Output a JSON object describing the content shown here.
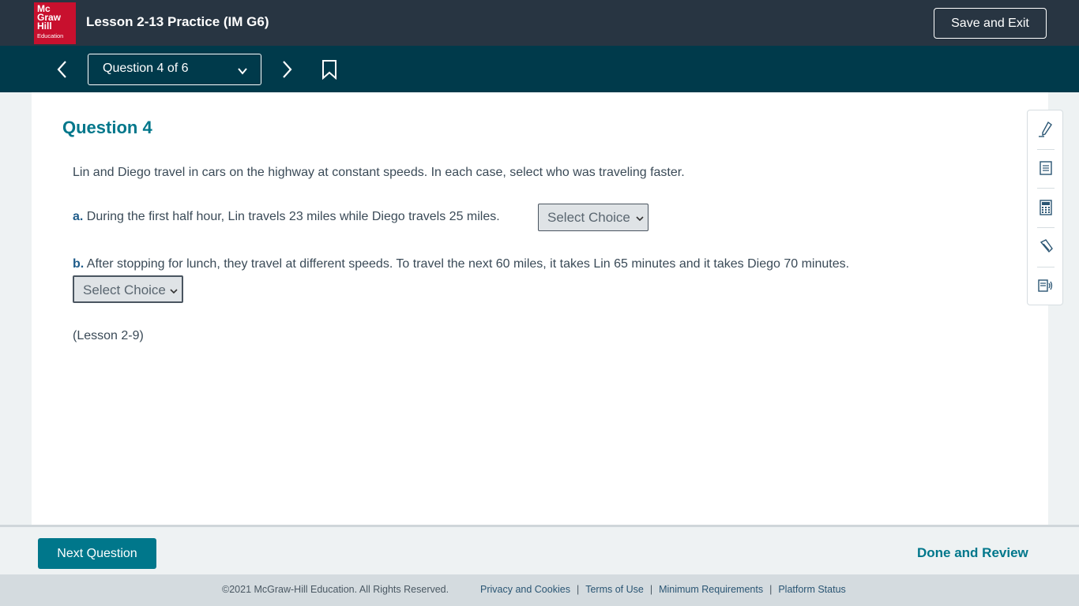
{
  "header": {
    "logo": {
      "line1": "Mc",
      "line2": "Graw",
      "line3": "Hill",
      "line4": "Education",
      "color": "#c8102e"
    },
    "title": "Lesson 2-13 Practice (IM G6)",
    "save_exit_label": "Save and Exit"
  },
  "nav": {
    "question_selector": "Question 4 of 6",
    "icons": [
      "chevron-left-icon",
      "chevron-right-icon",
      "chevron-down-icon",
      "bookmark-icon"
    ]
  },
  "question": {
    "heading": "Question 4",
    "intro": "Lin and Diego travel in cars on the highway at constant speeds. In each case, select who was traveling faster.",
    "part_a": {
      "label": "a.",
      "text": "During the first half hour, Lin travels 23 miles while Diego travels 25 miles.",
      "select_value": "Select Choice"
    },
    "part_b": {
      "label": "b.",
      "text": "After stopping for lunch, they travel at different speeds. To travel the next 60 miles, it takes Lin 65 minutes and it takes Diego 70 minutes.",
      "select_value": "Select Choice"
    },
    "lesson_ref": "(Lesson 2-9)"
  },
  "tools": [
    "pen-icon",
    "notes-icon",
    "calculator-icon",
    "highlighter-icon",
    "read-aloud-icon"
  ],
  "footer_actions": {
    "next_label": "Next Question",
    "done_label": "Done and Review"
  },
  "footer": {
    "copyright": "©2021 McGraw-Hill Education. All Rights Reserved.",
    "links": [
      "Privacy and Cookies",
      "Terms of Use",
      "Minimum Requirements",
      "Platform Status"
    ],
    "separator": "|"
  },
  "colors": {
    "top_bar": "#283542",
    "nav_bar": "#003a4b",
    "accent": "#00778b"
  }
}
